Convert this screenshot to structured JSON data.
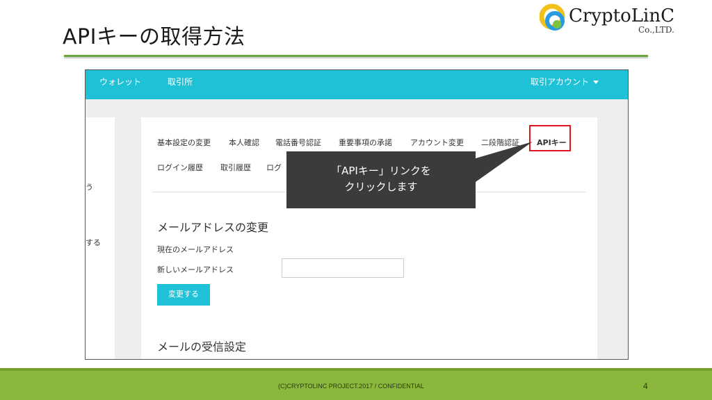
{
  "slide": {
    "title": "APIキーの取得方法",
    "footer": "(C)CRYPTOLINC PROJECT.2017 / CONFIDENTIAL",
    "page_number": "4"
  },
  "logo": {
    "name": "CryptoLinC",
    "subtitle": "Co.,LTD."
  },
  "navbar": {
    "wallet": "ウォレット",
    "exchange": "取引所",
    "account": "取引アカウント",
    "account_icon": "caret-down-icon"
  },
  "left_panel": {
    "text1": "う",
    "text2": "する"
  },
  "settings_tabs": {
    "row1": [
      "基本設定の変更",
      "本人確認",
      "電話番号認証",
      "重要事項の承諾",
      "アカウント変更",
      "二段階認証",
      "APIキー"
    ],
    "row2": [
      "ログイン履歴",
      "取引履歴",
      "ログ"
    ],
    "active": "APIキー"
  },
  "email_section": {
    "title": "メールアドレスの変更",
    "current_label": "現在のメールアドレス",
    "new_label": "新しいメールアドレス",
    "new_value": "",
    "submit": "変更する"
  },
  "receive_section": {
    "title": "メールの受信設定"
  },
  "callout": {
    "line1": "「APIキー」リンクを",
    "line2": "クリックします"
  },
  "colors": {
    "accent": "#1ec1d6",
    "highlight": "#e0141e",
    "title_rule": "#6aa83b",
    "footer": "#8ab73c",
    "callout_bg": "#3b3b3b"
  }
}
